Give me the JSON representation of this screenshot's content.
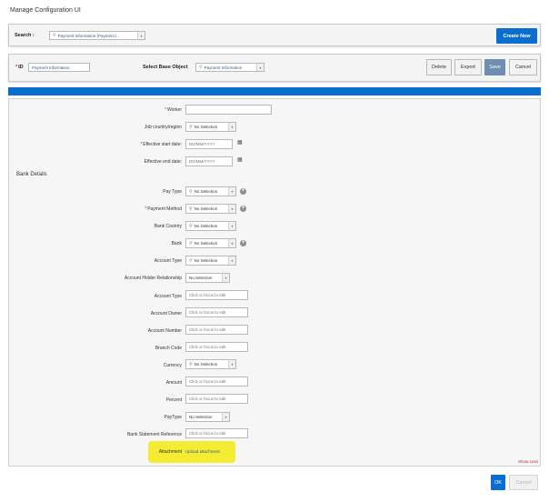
{
  "title": "Manage Configuration UI",
  "search": {
    "label": "Search :",
    "value": "Payment Information (Payment I..."
  },
  "create_new": "Create New",
  "id_field": {
    "label": "ID",
    "value": "Payment Information"
  },
  "base_object": {
    "label": "Select Base Object",
    "value": "Payment Information"
  },
  "toolbar": {
    "delete": "Delete",
    "export": "Export",
    "save": "Save",
    "cancel": "Cancel"
  },
  "fields": {
    "worker": {
      "label": "Worker",
      "value": ""
    },
    "job_country": {
      "label": "Job country/region",
      "value": "No Selection"
    },
    "eff_start": {
      "label": "Effective start date:",
      "placeholder": "DD/MM/YYYY"
    },
    "eff_end": {
      "label": "Effective end date:",
      "placeholder": "DD/MM/YYYY"
    }
  },
  "bank_details": {
    "title": "Bank Details",
    "pay_type": {
      "label": "Pay Type",
      "value": "No Selection"
    },
    "payment_method": {
      "label": "Payment Method",
      "value": "No Selection"
    },
    "bank_country": {
      "label": "Bank Country",
      "value": "No Selection"
    },
    "bank": {
      "label": "Bank",
      "value": "No Selection"
    },
    "account_type_sel": {
      "label": "Account Type",
      "value": "No Selection"
    },
    "account_holder_rel": {
      "label": "Account Holder Relationship",
      "value": "No Selection"
    },
    "account_type_txt": {
      "label": "Account Type",
      "placeholder": "Click or focus to edit"
    },
    "account_owner": {
      "label": "Account Owner",
      "placeholder": "Click or focus to edit"
    },
    "account_number": {
      "label": "Account Number",
      "placeholder": "Click or focus to edit"
    },
    "branch_code": {
      "label": "Branch Code",
      "placeholder": "Click or focus to edit"
    },
    "currency": {
      "label": "Currency",
      "value": "No Selection"
    },
    "amount": {
      "label": "Amount",
      "placeholder": "Click or focus to edit"
    },
    "percent": {
      "label": "Percent",
      "placeholder": "Click or focus to edit"
    },
    "paytype2": {
      "label": "PayType",
      "value": "No Selection"
    },
    "bank_stmt_ref": {
      "label": "Bank Statement Reference",
      "placeholder": "Click or focus to edit"
    },
    "attachment": {
      "label": "Attachment",
      "link": "Upload attachment"
    }
  },
  "show_less": "Show Less",
  "footer": {
    "ok": "OK",
    "cancel": "Cancel"
  },
  "colors": {
    "accent": "#0a6ed1",
    "highlight": "#f4ec32",
    "required": "#c62828"
  },
  "icons": {
    "search": "search-icon",
    "dropdown": "chevron-down-icon",
    "add": "add-circle-icon",
    "calendar": "calendar-icon"
  }
}
